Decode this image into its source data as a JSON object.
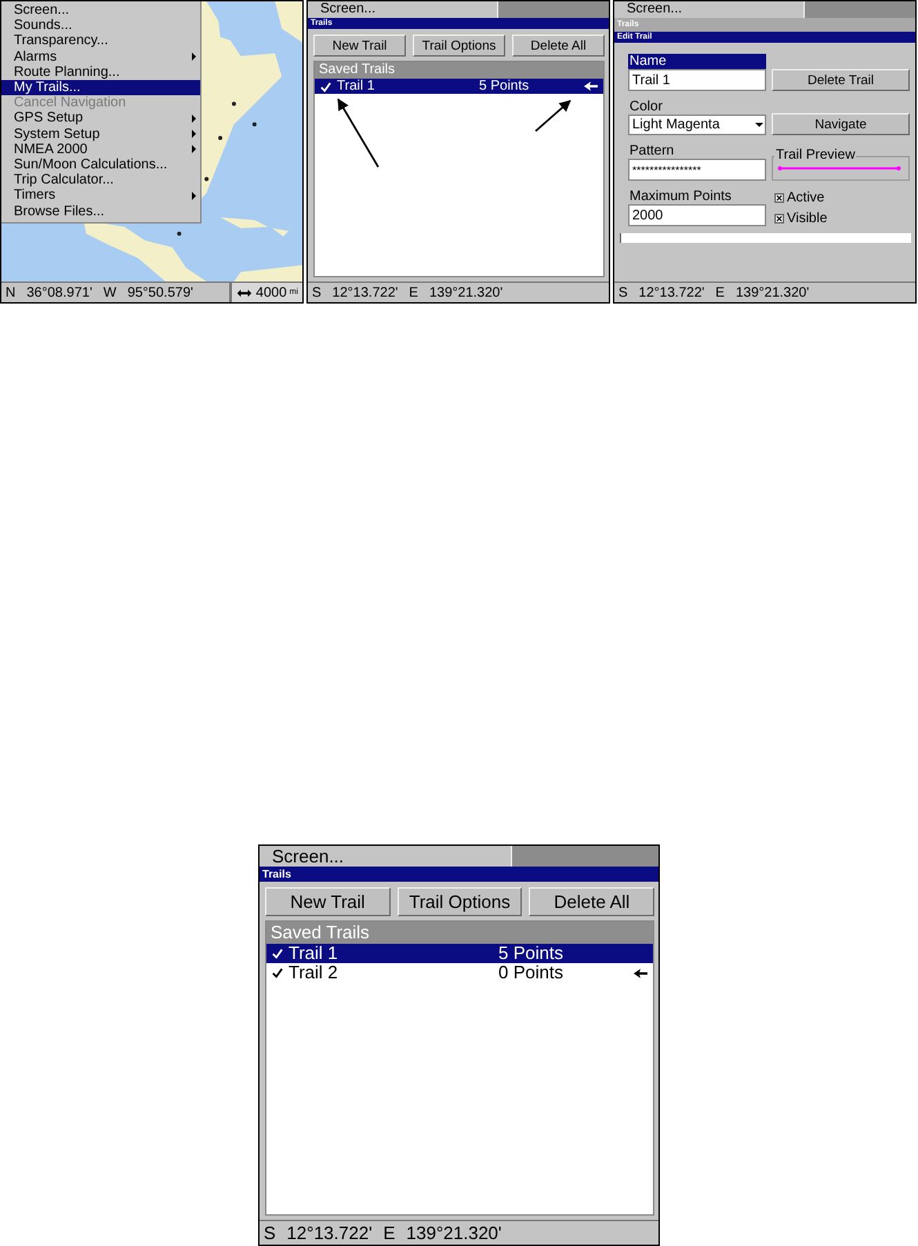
{
  "top_row": [
    {
      "kind": "map_menu",
      "menu": [
        {
          "label": "Screen...",
          "submenu": false,
          "disabled": false,
          "selected": false
        },
        {
          "label": "Sounds...",
          "submenu": false,
          "disabled": false,
          "selected": false
        },
        {
          "label": "Transparency...",
          "submenu": false,
          "disabled": false,
          "selected": false
        },
        {
          "label": "Alarms",
          "submenu": true,
          "disabled": false,
          "selected": false
        },
        {
          "label": "Route Planning...",
          "submenu": false,
          "disabled": false,
          "selected": false
        },
        {
          "label": "My Trails...",
          "submenu": false,
          "disabled": false,
          "selected": true
        },
        {
          "label": "Cancel Navigation",
          "submenu": false,
          "disabled": true,
          "selected": false
        },
        {
          "label": "GPS Setup",
          "submenu": true,
          "disabled": false,
          "selected": false
        },
        {
          "label": "System Setup",
          "submenu": true,
          "disabled": false,
          "selected": false
        },
        {
          "label": "NMEA 2000",
          "submenu": true,
          "disabled": false,
          "selected": false
        },
        {
          "label": "Sun/Moon Calculations...",
          "submenu": false,
          "disabled": false,
          "selected": false
        },
        {
          "label": "Trip Calculator...",
          "submenu": false,
          "disabled": false,
          "selected": false
        },
        {
          "label": "Timers",
          "submenu": true,
          "disabled": false,
          "selected": false
        },
        {
          "label": "Browse Files...",
          "submenu": false,
          "disabled": false,
          "selected": false
        }
      ],
      "coordinates": [
        "N",
        "36°08.971'",
        "W",
        "95°50.579'"
      ],
      "zoom": "4000",
      "zoom_unit": "mi"
    },
    {
      "kind": "trail_list",
      "tab": "Screen...",
      "title": "Trails",
      "buttons": [
        "New Trail",
        "Trail Options",
        "Delete All"
      ],
      "list_header": "Saved Trails",
      "callouts": true,
      "trails": [
        {
          "name": "Trail 1",
          "points": "5 Points",
          "checked": true,
          "selected": true,
          "pointer": true
        }
      ],
      "coordinates": [
        "S",
        "12°13.722'",
        "E",
        "139°21.320'"
      ]
    },
    {
      "kind": "edit_trail",
      "tab": "Screen...",
      "title": "Trails",
      "subtitle": "Edit Trail",
      "name": {
        "label": "Name",
        "value": "Trail 1",
        "focused": true
      },
      "delete_button": "Delete Trail",
      "color": {
        "label": "Color",
        "value": "Light Magenta"
      },
      "navigate_button": "Navigate",
      "pattern": {
        "label": "Pattern",
        "value": "****************"
      },
      "preview_label": "Trail Preview",
      "max_points": {
        "label": "Maximum Points",
        "value": "2000"
      },
      "options": [
        {
          "label": "Active",
          "checked": true
        },
        {
          "label": "Visible",
          "checked": true
        }
      ],
      "coordinates": [
        "S",
        "12°13.722'",
        "E",
        "139°21.320'"
      ]
    }
  ],
  "featured": {
    "kind": "trail_list",
    "tab": "Screen...",
    "title": "Trails",
    "buttons": [
      "New Trail",
      "Trail Options",
      "Delete All"
    ],
    "list_header": "Saved Trails",
    "callouts": false,
    "trails": [
      {
        "name": "Trail 1",
        "points": "5 Points",
        "checked": true,
        "selected": true,
        "pointer": false
      },
      {
        "name": "Trail 2",
        "points": "0 Points",
        "checked": true,
        "selected": false,
        "pointer": true
      }
    ],
    "coordinates": [
      "S",
      "12°13.722'",
      "E",
      "139°21.320'"
    ]
  }
}
